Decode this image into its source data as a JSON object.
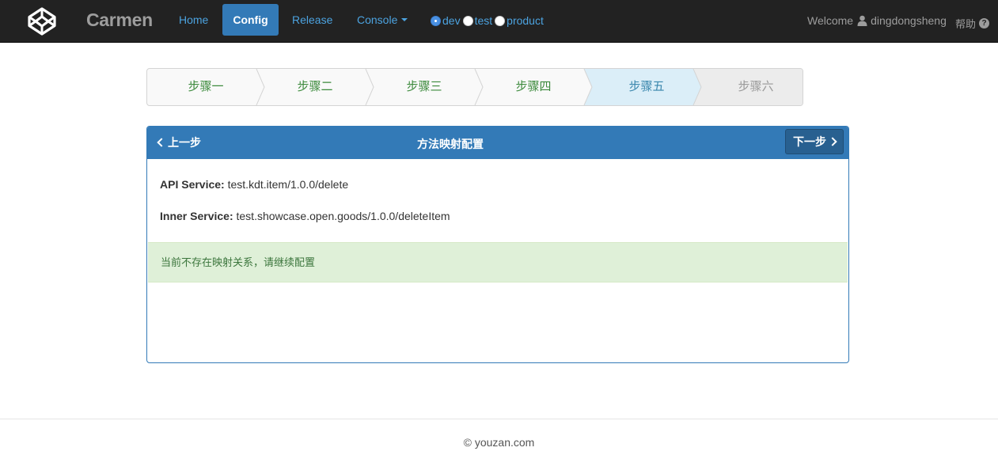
{
  "navbar": {
    "brand": "Carmen",
    "links": {
      "home": "Home",
      "config": "Config",
      "release": "Release",
      "console": "Console"
    },
    "environments": [
      {
        "label": "dev",
        "selected": true
      },
      {
        "label": "test",
        "selected": false
      },
      {
        "label": "product",
        "selected": false
      }
    ],
    "welcome_prefix": "Welcome",
    "username": "dingdongsheng",
    "help": "帮助",
    "icons": [
      "codepen-logo-icon",
      "user-icon",
      "question-circle-icon",
      "caret-down-icon"
    ],
    "colors": {
      "bg": "#222222",
      "link": "#4ca3e0",
      "active": "#337ab7"
    }
  },
  "steps": [
    {
      "label": "步骤一",
      "state": "done"
    },
    {
      "label": "步骤二",
      "state": "done"
    },
    {
      "label": "步骤三",
      "state": "done"
    },
    {
      "label": "步骤四",
      "state": "done"
    },
    {
      "label": "步骤五",
      "state": "active"
    },
    {
      "label": "步骤六",
      "state": "disabled"
    }
  ],
  "panel": {
    "prev": "上一步",
    "title": "方法映射配置",
    "next": "下一步",
    "api_service_label": "API Service:",
    "api_service_value": "test.kdt.item/1.0.0/delete",
    "inner_service_label": "Inner Service:",
    "inner_service_value": "test.showcase.open.goods/1.0.0/deleteItem",
    "alert": "当前不存在映射关系，请继续配置"
  },
  "footer": {
    "copyright": "© youzan.com"
  }
}
